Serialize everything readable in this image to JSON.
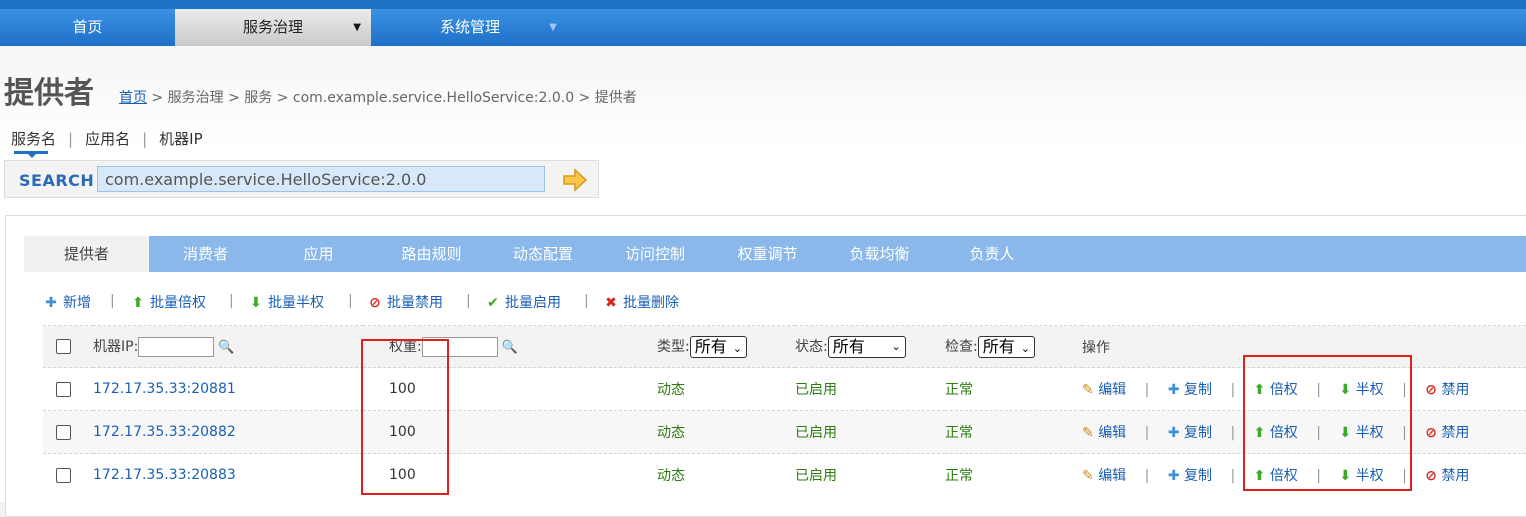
{
  "nav": {
    "items": [
      {
        "label": "首页",
        "active": false
      },
      {
        "label": "服务治理",
        "active": true,
        "caret": "▼"
      },
      {
        "label": "系统管理",
        "active": false,
        "caret": "▼"
      }
    ]
  },
  "page": {
    "title": "提供者",
    "breadcrumb": {
      "home": "首页",
      "rest": " > 服务治理 > 服务 > com.example.service.HelloService:2.0.0 > 提供者"
    }
  },
  "search": {
    "tabs": [
      "服务名",
      "应用名",
      "机器IP"
    ],
    "tab_sep": "|",
    "label": "SEARCH",
    "value": "com.example.service.HelloService:2.0.0",
    "go_icon": "arrow-right-icon"
  },
  "tabs": [
    "提供者",
    "消费者",
    "应用",
    "路由规则",
    "动态配置",
    "访问控制",
    "权重调节",
    "负载均衡",
    "负责人"
  ],
  "toolbar": {
    "add": "新增",
    "batch_double": "批量倍权",
    "batch_half": "批量半权",
    "batch_disable": "批量禁用",
    "batch_enable": "批量启用",
    "batch_delete": "批量删除",
    "sep": "|"
  },
  "table": {
    "head": {
      "ip_label": "机器IP:",
      "weight_label": "权重:",
      "type_label": "类型:",
      "type_value": "所有",
      "status_label": "状态:",
      "status_value": "所有",
      "check_label": "检查:",
      "check_value": "所有",
      "ops_label": "操作"
    },
    "ops": {
      "edit": "编辑",
      "copy": "复制",
      "double": "倍权",
      "half": "半权",
      "disable": "禁用",
      "sep": "|"
    },
    "rows": [
      {
        "ip": "172.17.35.33:20881",
        "weight": "100",
        "type": "动态",
        "status": "已启用",
        "check": "正常"
      },
      {
        "ip": "172.17.35.33:20882",
        "weight": "100",
        "type": "动态",
        "status": "已启用",
        "check": "正常"
      },
      {
        "ip": "172.17.35.33:20883",
        "weight": "100",
        "type": "动态",
        "status": "已启用",
        "check": "正常"
      }
    ]
  },
  "colors": {
    "nav_blue": "#1e73c6",
    "tab_blue": "#8ab8ea",
    "link_blue": "#1a5fb4",
    "status_green": "#2e7d10",
    "highlight_red": "#e02020"
  }
}
